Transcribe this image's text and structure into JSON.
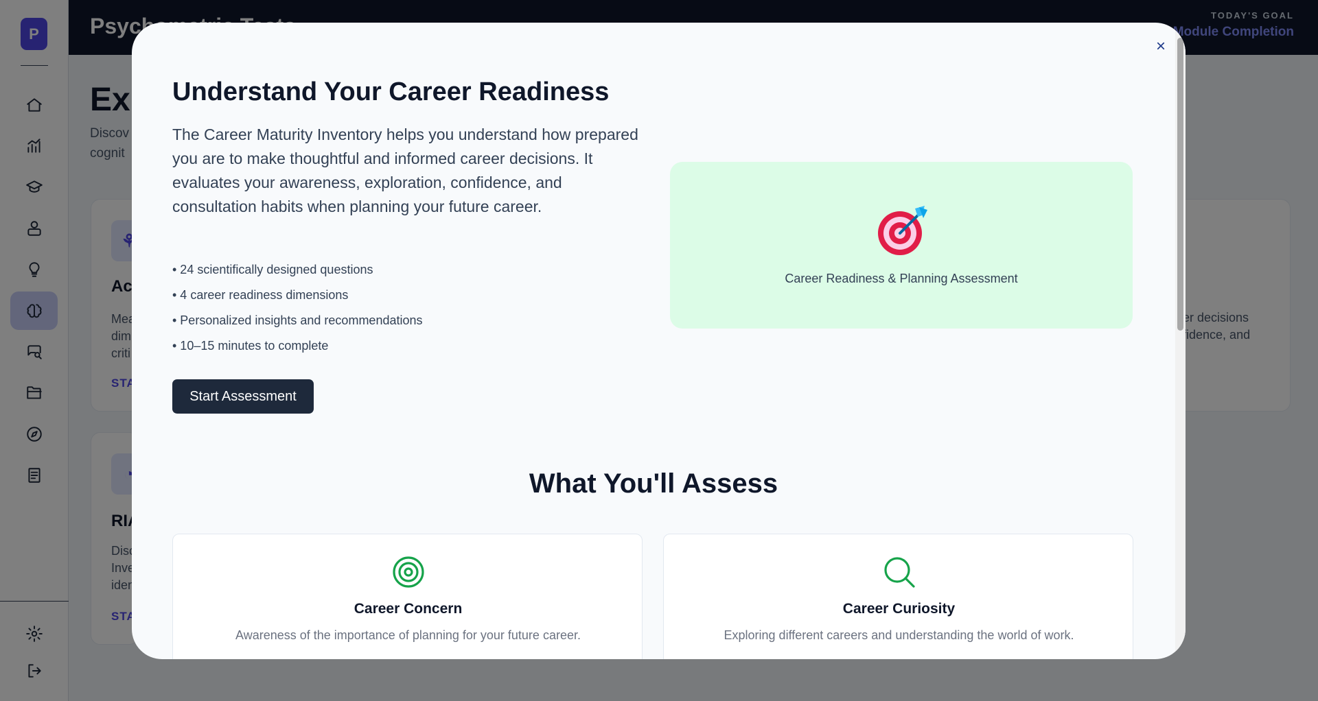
{
  "app": {
    "logo_letter": "P",
    "title": "Psychometric Tests",
    "goal_label": "TODAY'S GOAL",
    "goal_value": "Module Completion"
  },
  "sidebar": {
    "items": [
      {
        "icon": "home-icon"
      },
      {
        "icon": "analytics-icon"
      },
      {
        "icon": "graduation-cap-icon"
      },
      {
        "icon": "career-icon"
      },
      {
        "icon": "lightbulb-icon"
      },
      {
        "icon": "brain-icon",
        "active": true
      },
      {
        "icon": "chat-search-icon"
      },
      {
        "icon": "folder-icon"
      },
      {
        "icon": "compass-icon"
      },
      {
        "icon": "document-icon"
      }
    ],
    "footer": [
      {
        "icon": "settings-icon"
      },
      {
        "icon": "logout-icon"
      }
    ]
  },
  "background": {
    "heading": "Exp",
    "desc_line1": "Discov",
    "desc_line2": "cognit",
    "cards": [
      {
        "title": "Aca",
        "text_lines": [
          "Mea",
          "dim",
          "criti"
        ],
        "link": "STA"
      },
      {
        "title": "RIA",
        "text_lines": [
          "Disc",
          "Inve",
          "iden"
        ],
        "link": "STA"
      }
    ],
    "right_card_lines": [
      "eer decisions",
      "nfidence, and"
    ]
  },
  "modal": {
    "title": "Understand Your Career Readiness",
    "description": "The Career Maturity Inventory helps you understand how prepared you are to make thoughtful and informed career decisions. It evaluates your awareness, exploration, confidence, and consultation habits when planning your future career.",
    "bullets": [
      "• 24 scientifically designed questions",
      "• 4 career readiness dimensions",
      "• Personalized insights and recommendations",
      "• 10–15 minutes to complete"
    ],
    "start_button": "Start Assessment",
    "close_label": "×",
    "hero_caption": "Career Readiness & Planning Assessment",
    "hero_icon": "bullseye-dart-emoji",
    "section_title": "What You'll Assess",
    "features": [
      {
        "icon": "target-icon",
        "title": "Career Concern",
        "text": "Awareness of the importance of planning for your future career."
      },
      {
        "icon": "search-icon",
        "title": "Career Curiosity",
        "text": "Exploring different careers and understanding the world of work."
      }
    ]
  },
  "colors": {
    "accent": "#4f46e5",
    "topbar": "#0f172a",
    "hero_bg": "#dcfce7",
    "feature_icon": "#16a34a",
    "button_bg": "#1e293b"
  }
}
